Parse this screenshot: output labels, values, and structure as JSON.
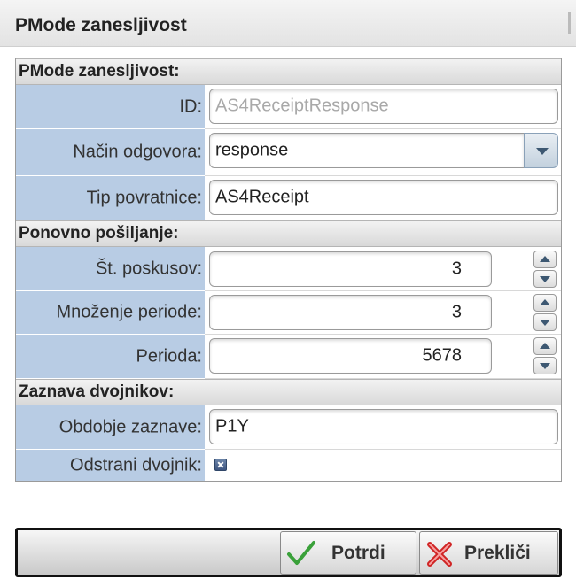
{
  "dialog": {
    "title": "PMode zanesljivost"
  },
  "sections": {
    "reliability": {
      "title": "PMode zanesljivost:",
      "id_label": "ID:",
      "id_value": "AS4ReceiptResponse",
      "mode_label": "Način odgovora:",
      "mode_value": "response",
      "receipt_label": "Tip povratnice:",
      "receipt_value": "AS4Receipt"
    },
    "resend": {
      "title": "Ponovno pošiljanje:",
      "attempts_label": "Št. poskusov:",
      "attempts_value": "3",
      "multiplier_label": "Množenje periode:",
      "multiplier_value": "3",
      "period_label": "Perioda:",
      "period_value": "5678"
    },
    "duplicates": {
      "title": "Zaznava dvojnikov:",
      "window_label": "Obdobje zaznave:",
      "window_value": "P1Y",
      "remove_label": "Odstrani dvojnik:",
      "remove_checked": true
    }
  },
  "footer": {
    "confirm_label": "Potrdi",
    "confirm_icon": "checkmark-icon",
    "cancel_label": "Prekliči",
    "cancel_icon": "cancel-x-icon"
  },
  "colors": {
    "label_bg": "#b8cce4",
    "accent": "#3d5872",
    "confirm_icon": "#3aa13a",
    "cancel_icon": "#d02525"
  }
}
